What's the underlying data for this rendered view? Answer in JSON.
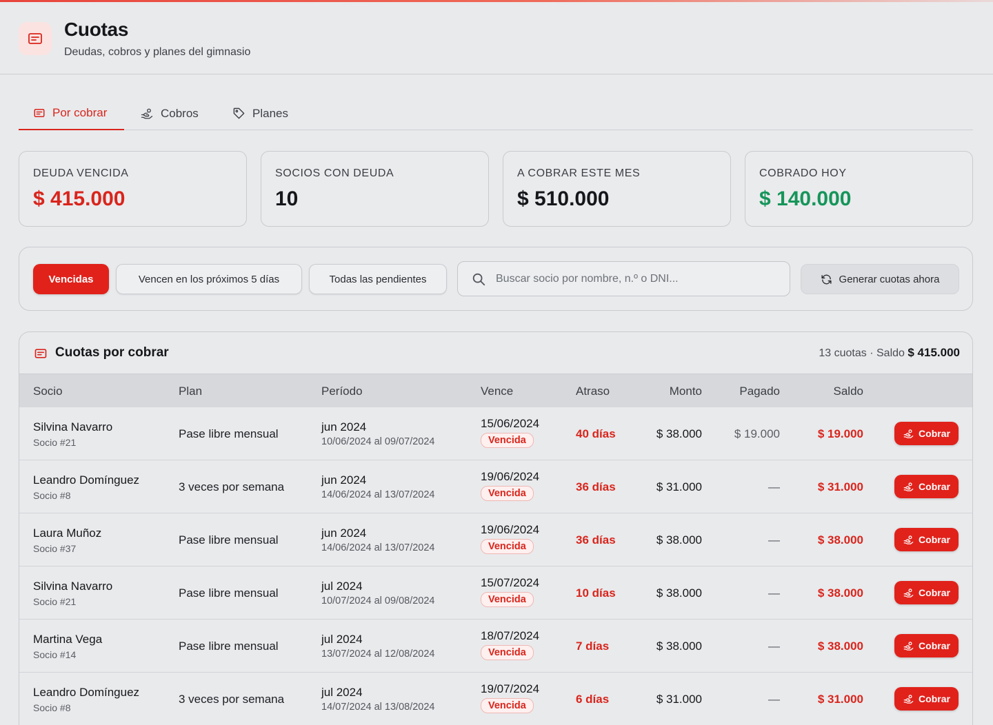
{
  "header": {
    "title": "Cuotas",
    "subtitle": "Deudas, cobros y planes del gimnasio"
  },
  "tabs": [
    {
      "label": "Por cobrar",
      "icon": "receipt-icon",
      "active": true
    },
    {
      "label": "Cobros",
      "icon": "hand-coins-icon",
      "active": false
    },
    {
      "label": "Planes",
      "icon": "tag-icon",
      "active": false
    }
  ],
  "stats": [
    {
      "label": "DEUDA VENCIDA",
      "value": "$ 415.000",
      "color": "#d9251c"
    },
    {
      "label": "SOCIOS CON DEUDA",
      "value": "10",
      "color": "#15171a"
    },
    {
      "label": "A COBRAR ESTE MES",
      "value": "$ 510.000",
      "color": "#15171a"
    },
    {
      "label": "COBRADO HOY",
      "value": "$ 140.000",
      "color": "#16955a"
    }
  ],
  "filters": {
    "vencidas": "Vencidas",
    "proximos": "Vencen en los próximos 5 días",
    "todas": "Todas las pendientes",
    "search_placeholder": "Buscar socio por nombre, n.º o DNI...",
    "generate": "Generar cuotas ahora"
  },
  "panel": {
    "title": "Cuotas por cobrar",
    "summary_prefix": "13 cuotas · Saldo ",
    "summary_total": "$ 415.000",
    "columns": {
      "socio": "Socio",
      "plan": "Plan",
      "periodo": "Período",
      "vence": "Vence",
      "atraso": "Atraso",
      "monto": "Monto",
      "pagado": "Pagado",
      "saldo": "Saldo"
    },
    "cobrar_label": "Cobrar",
    "rows": [
      {
        "name": "Silvina Navarro",
        "id": "Socio #21",
        "plan": "Pase libre mensual",
        "period": "jun 2024",
        "range": "10/06/2024 al 09/07/2024",
        "due": "15/06/2024",
        "status": "Vencida",
        "delay": "40 días",
        "amount": "$ 38.000",
        "paid": "$ 19.000",
        "balance": "$ 19.000"
      },
      {
        "name": "Leandro Domínguez",
        "id": "Socio #8",
        "plan": "3 veces por semana",
        "period": "jun 2024",
        "range": "14/06/2024 al 13/07/2024",
        "due": "19/06/2024",
        "status": "Vencida",
        "delay": "36 días",
        "amount": "$ 31.000",
        "paid": "—",
        "balance": "$ 31.000"
      },
      {
        "name": "Laura Muñoz",
        "id": "Socio #37",
        "plan": "Pase libre mensual",
        "period": "jun 2024",
        "range": "14/06/2024 al 13/07/2024",
        "due": "19/06/2024",
        "status": "Vencida",
        "delay": "36 días",
        "amount": "$ 38.000",
        "paid": "—",
        "balance": "$ 38.000"
      },
      {
        "name": "Silvina Navarro",
        "id": "Socio #21",
        "plan": "Pase libre mensual",
        "period": "jul 2024",
        "range": "10/07/2024 al 09/08/2024",
        "due": "15/07/2024",
        "status": "Vencida",
        "delay": "10 días",
        "amount": "$ 38.000",
        "paid": "—",
        "balance": "$ 38.000"
      },
      {
        "name": "Martina Vega",
        "id": "Socio #14",
        "plan": "Pase libre mensual",
        "period": "jul 2024",
        "range": "13/07/2024 al 12/08/2024",
        "due": "18/07/2024",
        "status": "Vencida",
        "delay": "7 días",
        "amount": "$ 38.000",
        "paid": "—",
        "balance": "$ 38.000"
      },
      {
        "name": "Leandro Domínguez",
        "id": "Socio #8",
        "plan": "3 veces por semana",
        "period": "jul 2024",
        "range": "14/07/2024 al 13/08/2024",
        "due": "19/07/2024",
        "status": "Vencida",
        "delay": "6 días",
        "amount": "$ 31.000",
        "paid": "—",
        "balance": "$ 31.000"
      }
    ]
  }
}
